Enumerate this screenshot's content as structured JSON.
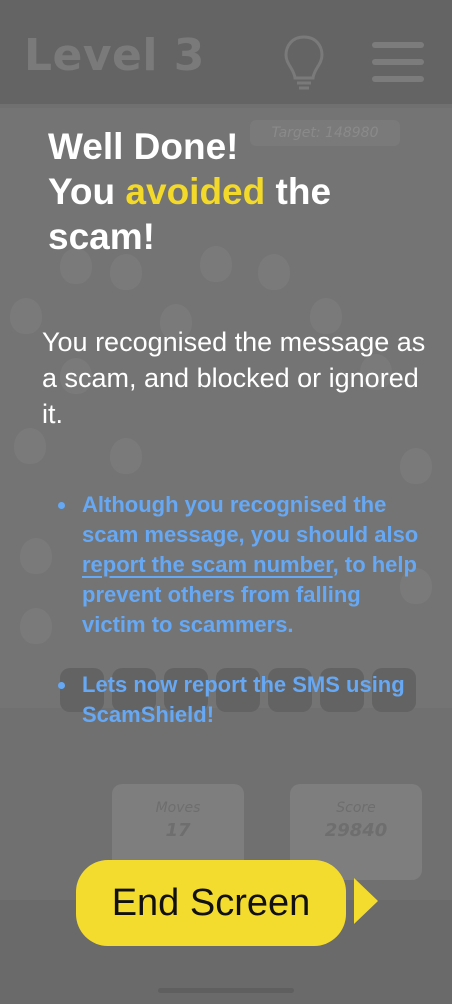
{
  "background": {
    "level_title": "Level 3",
    "target_text": "Target: 148980",
    "moves_label": "Moves",
    "moves_value": "17",
    "score_label": "Score",
    "score_value": "29840",
    "icons": [
      "lightbulb-icon",
      "hamburger-menu-icon"
    ]
  },
  "overlay": {
    "headline_line1": "Well Done!",
    "headline_you": "You ",
    "headline_accent": "avoided",
    "headline_rest": " the scam!",
    "intro": "You recognised the message as a scam, and blocked or ignored it.",
    "tip1_before": "Although you recognised the scam message, you should also ",
    "tip1_link": "report the scam number",
    "tip1_after": ", to help prevent others from falling victim to scammers.",
    "tip2": "Lets now report the SMS using ScamShield!",
    "end_button_label": "End Screen"
  },
  "colors": {
    "accent_yellow": "#f3d92a",
    "tip_blue": "#66a8f4",
    "overlay_bg": "#6b6b6b",
    "button_bg": "#f4dc2e"
  }
}
